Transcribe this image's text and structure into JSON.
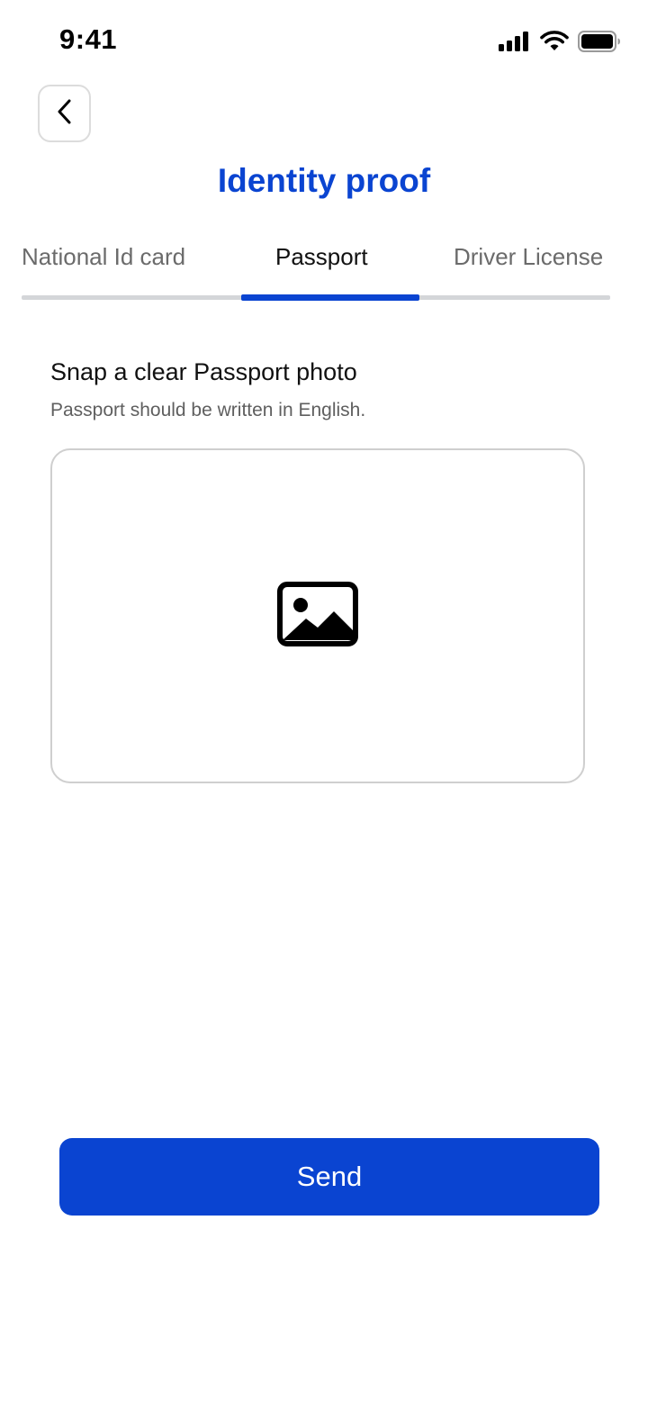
{
  "status_bar": {
    "time": "9:41"
  },
  "header": {
    "title": "Identity proof",
    "back_icon": "chevron-left-icon"
  },
  "tabs": [
    {
      "label": "National Id card",
      "active": false
    },
    {
      "label": "Passport",
      "active": true
    },
    {
      "label": "Driver License",
      "active": false
    }
  ],
  "content": {
    "heading": "Snap a clear Passport photo",
    "subtext": "Passport should be written in English.",
    "upload_icon": "image-icon"
  },
  "actions": {
    "send_label": "Send"
  },
  "colors": {
    "accent": "#0a44d1",
    "tab_track": "#d4d6d9",
    "border": "#cfcfcf"
  }
}
